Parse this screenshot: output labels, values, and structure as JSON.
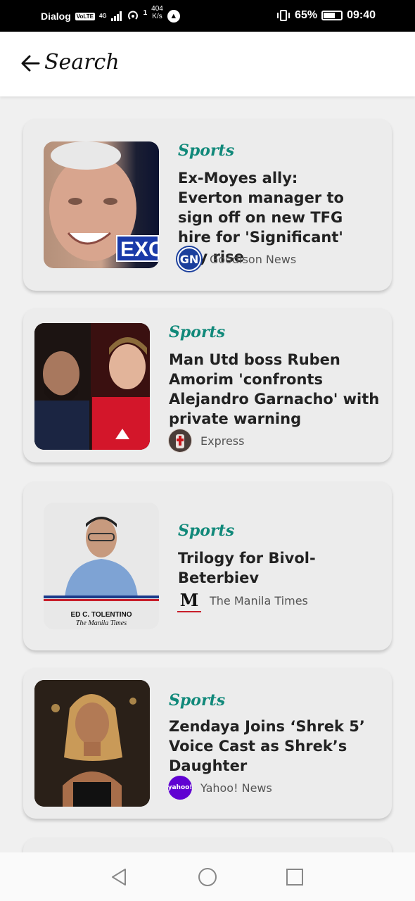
{
  "status_bar": {
    "carrier": "Dialog",
    "volte": "VoLTE",
    "network": "4G",
    "data_speed_value": "404",
    "data_speed_unit": "K/s",
    "speed_superscript": "1",
    "battery_percent": "65%",
    "battery_level": 0.65,
    "time": "09:40"
  },
  "header": {
    "title": "Search"
  },
  "articles": [
    {
      "category": "Sports",
      "headline": "Ex-Moyes ally: Everton manager to sign off on new TFG hire for 'Significant' pay rise",
      "source": "Goodison News",
      "source_logo_text": "GN",
      "thumb_text": "EXCL"
    },
    {
      "category": "Sports",
      "headline": "Man Utd boss Ruben Amorim 'confronts Alejandro Garnacho' with private warning",
      "source": "Express"
    },
    {
      "category": "Sports",
      "headline": "Trilogy for Bivol-Beterbiev",
      "source": "The Manila Times",
      "source_logo_text": "M",
      "thumb_caption_name": "ED C. TOLENTINO",
      "thumb_caption_pub": "The Manila Times"
    },
    {
      "category": "Sports",
      "headline": "Zendaya Joins ‘Shrek 5’ Voice Cast as Shrek’s Daughter",
      "source": "Yahoo! News",
      "source_logo_text": "yahoo!"
    }
  ],
  "colors": {
    "category": "#11897a",
    "background": "#f0f0f0",
    "card": "#ececec"
  }
}
